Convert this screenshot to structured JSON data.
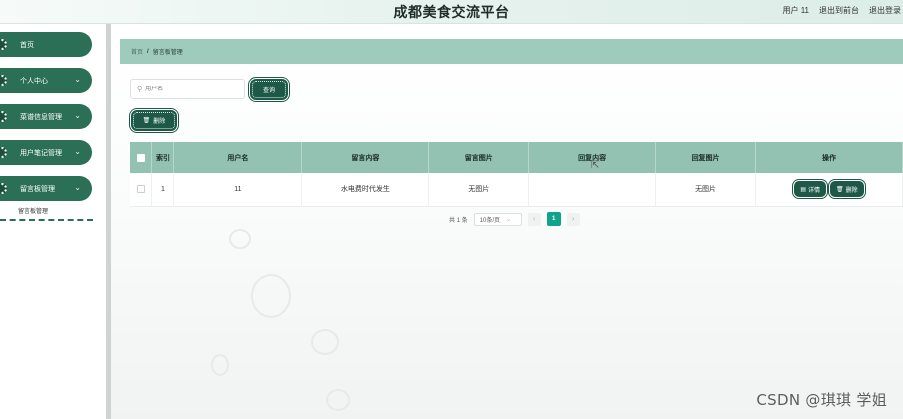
{
  "header": {
    "site_title": "成都美食交流平台",
    "user_label": "用户 11",
    "back_label": "退出到前台",
    "logout_label": "退出登录"
  },
  "sidebar": {
    "items": [
      {
        "label": "首页",
        "icon": "home-icon"
      },
      {
        "label": "个人中心",
        "icon": "user-icon"
      },
      {
        "label": "菜谱信息管理",
        "icon": "recipe-icon"
      },
      {
        "label": "用户笔记管理",
        "icon": "note-icon"
      },
      {
        "label": "留言板管理",
        "icon": "message-icon"
      }
    ],
    "arrow": "⌄",
    "sub_item": "留言板管理"
  },
  "breadcrumb": {
    "home": "首页",
    "separator": "/",
    "current": "留言板管理"
  },
  "search": {
    "placeholder": "用户名",
    "query_label": "查询"
  },
  "toolbar": {
    "delete_label": "删除"
  },
  "table": {
    "headers": [
      "索引",
      "用户名",
      "留言内容",
      "留言图片",
      "回复内容",
      "回复图片",
      "操作"
    ],
    "rows": [
      {
        "index": "1",
        "username": "11",
        "content": "水电费时代发生",
        "image": "无图片",
        "reply": "",
        "reply_image": "无图片"
      }
    ],
    "detail_label": "详情",
    "row_delete_label": "删除"
  },
  "pagination": {
    "total": "共 1 条",
    "page_size": "10条/页",
    "current_page": "1",
    "prev": "‹",
    "next": "›"
  },
  "watermark": "CSDN @琪琪 学姐",
  "colors": {
    "primary": "#1d5946",
    "menu": "#2b6f57",
    "table_header": "#93c2b2",
    "breadcrumb": "#9fcbbd",
    "page_active": "#11a28a"
  }
}
